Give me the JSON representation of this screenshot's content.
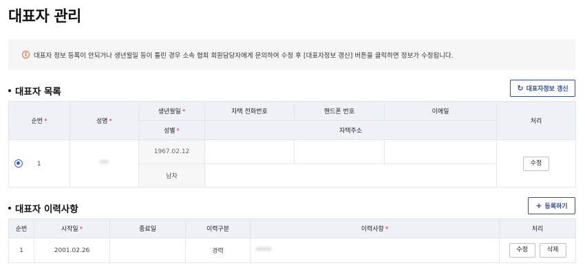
{
  "page": {
    "title": "대표자 관리"
  },
  "notice": {
    "icon": "info-icon",
    "text": "대표자 정보 등록이 안되거나 생년월일 등이 틀린 경우 소속 협회 회원담당자에게 문의하여 수정 후 [대표자정보 갱신] 버튼을 클릭하면 정보가 수정됩니다."
  },
  "rep_list": {
    "title": "대표자 목록",
    "refresh_button": "대표자정보 갱신",
    "headers": {
      "seq": "순번",
      "name": "성명",
      "birth": "생년월일",
      "home_phone": "자택 전화번호",
      "mobile": "핸드폰 번호",
      "email": "이메일",
      "action": "처리",
      "gender": "성별",
      "address": "자택주소"
    },
    "row": {
      "seq": "1",
      "name": "***",
      "birth": "1967.02.12",
      "home_phone": "",
      "mobile": "",
      "email": "",
      "gender": "남자",
      "address": "",
      "edit_button": "수정"
    }
  },
  "rep_history": {
    "title": "대표자 이력사항",
    "register_button": "등록하기",
    "headers": {
      "seq": "순번",
      "start": "시작일",
      "end": "종료일",
      "type": "이력구분",
      "history": "이력사항",
      "action": "처리"
    },
    "rows": [
      {
        "seq": "1",
        "start": "2001.02.26",
        "end": "",
        "type": "경력",
        "history": "*****",
        "edit_button": "수정",
        "delete_button": "삭제"
      }
    ]
  }
}
